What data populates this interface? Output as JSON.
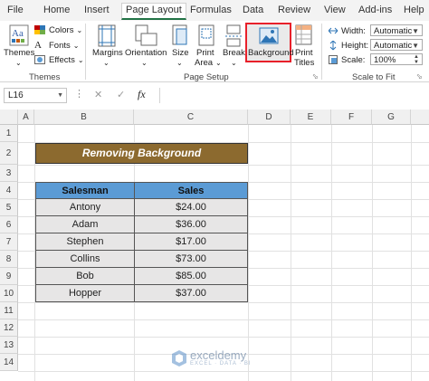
{
  "tabs": [
    "File",
    "Home",
    "Insert",
    "Page Layout",
    "Formulas",
    "Data",
    "Review",
    "View",
    "Add-ins",
    "Help"
  ],
  "active_tab": "Page Layout",
  "ribbon": {
    "themes": {
      "label": "Themes",
      "colors": "Colors",
      "fonts": "Fonts",
      "effects": "Effects",
      "group": "Themes"
    },
    "page_setup": {
      "margins": "Margins",
      "orientation": "Orientation",
      "size": "Size",
      "print_area_line1": "Print",
      "print_area_line2": "Area",
      "breaks": "Breaks",
      "background": "Background",
      "print_titles_line1": "Print",
      "print_titles_line2": "Titles",
      "group": "Page Setup"
    },
    "scale_to_fit": {
      "width_label": "Width:",
      "width_value": "Automatic",
      "height_label": "Height:",
      "height_value": "Automatic",
      "scale_label": "Scale:",
      "scale_value": "100%",
      "group": "Scale to Fit"
    },
    "highlight_color": "#e8202a"
  },
  "formula_bar": {
    "name_box": "L16",
    "cancel": "✕",
    "enter": "✓",
    "fx": "fx",
    "value": ""
  },
  "columns": [
    "A",
    "B",
    "C",
    "D",
    "E",
    "F",
    "G"
  ],
  "rows": [
    "1",
    "2",
    "3",
    "4",
    "5",
    "6",
    "7",
    "8",
    "9",
    "10",
    "11",
    "12",
    "13",
    "14"
  ],
  "sheet": {
    "title": "Removing Background",
    "title_bg": "#8c6a2f",
    "headers": [
      "Salesman",
      "Sales"
    ],
    "data": [
      [
        "Antony",
        "$24.00"
      ],
      [
        "Adam",
        "$36.00"
      ],
      [
        "Stephen",
        "$17.00"
      ],
      [
        "Collins",
        "$73.00"
      ],
      [
        "Bob",
        "$85.00"
      ],
      [
        "Hopper",
        "$37.00"
      ]
    ]
  },
  "watermark": {
    "name": "exceldemy",
    "tagline": "EXCEL · DATA · BI"
  }
}
